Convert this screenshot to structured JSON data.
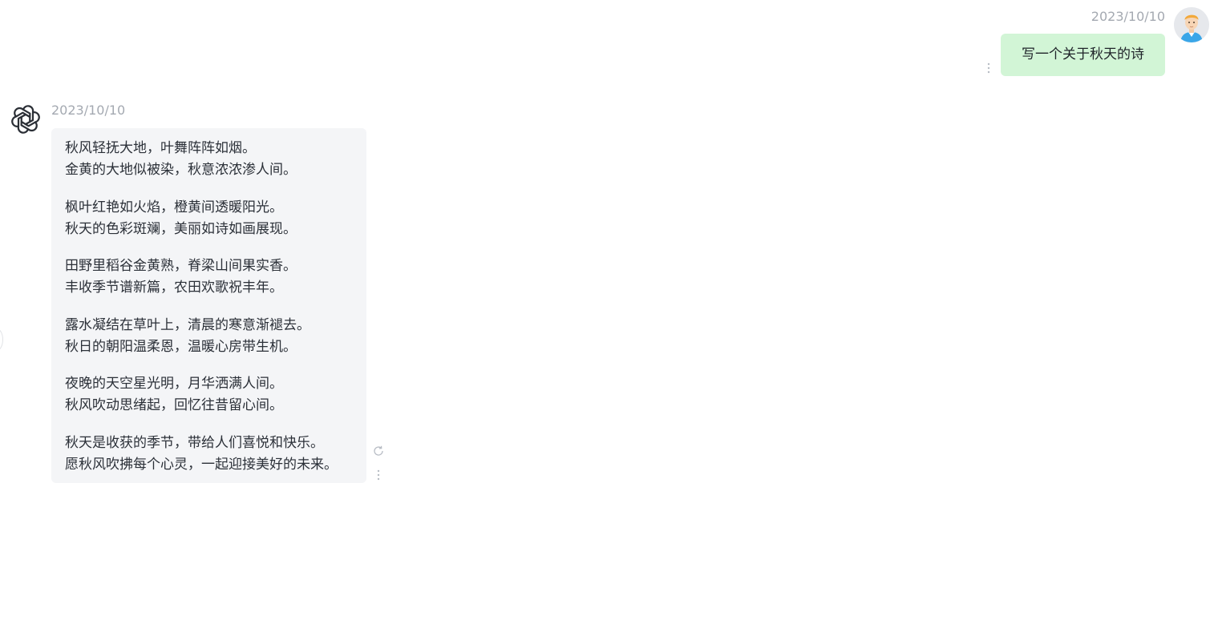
{
  "colors": {
    "user_bubble_bg": "#d2f5d6",
    "bot_bubble_bg": "#f4f5f7",
    "timestamp": "#a4a9b1",
    "text": "#2b3038"
  },
  "user_message": {
    "timestamp": "2023/10/10",
    "text": "写一个关于秋天的诗",
    "avatar_icon": "user-avatar-icon",
    "more_icon": "more-vertical-icon"
  },
  "bot_message": {
    "timestamp": "2023/10/10",
    "avatar_icon": "openai-logo-icon",
    "stanzas": [
      [
        "秋风轻抚大地，叶舞阵阵如烟。",
        "金黄的大地似被染，秋意浓浓渗人间。"
      ],
      [
        "枫叶红艳如火焰，橙黄间透暖阳光。",
        "秋天的色彩斑斓，美丽如诗如画展现。"
      ],
      [
        "田野里稻谷金黄熟，脊梁山间果实香。",
        "丰收季节谱新篇，农田欢歌祝丰年。"
      ],
      [
        "露水凝结在草叶上，清晨的寒意渐褪去。",
        "秋日的朝阳温柔恩，温暖心房带生机。"
      ],
      [
        "夜晚的天空星光明，月华洒满人间。",
        "秋风吹动思绪起，回忆往昔留心间。"
      ],
      [
        "秋天是收获的季节，带给人们喜悦和快乐。",
        "愿秋风吹拂每个心灵，一起迎接美好的未来。"
      ]
    ],
    "refresh_icon": "refresh-icon",
    "more_icon": "more-vertical-icon"
  }
}
